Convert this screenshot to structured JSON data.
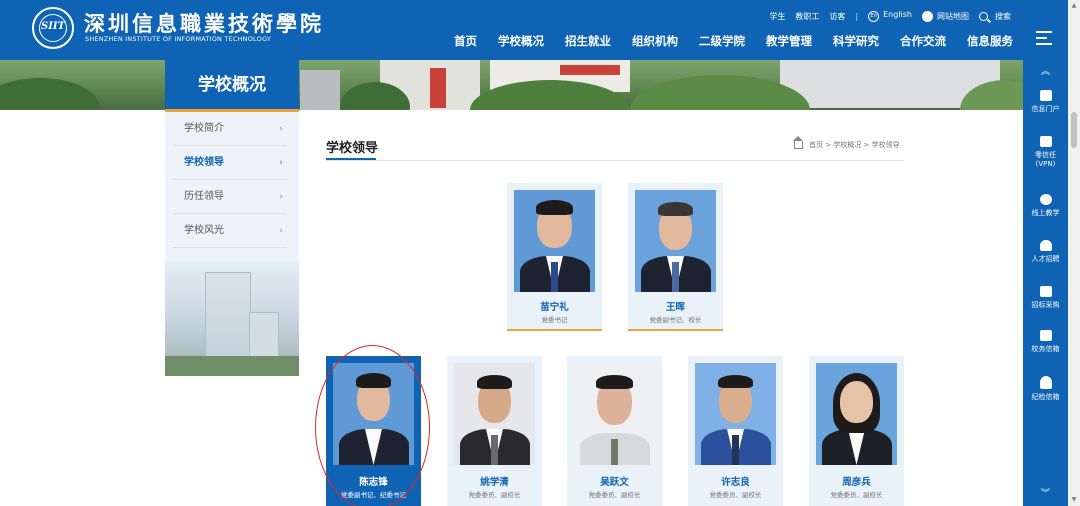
{
  "header": {
    "logo_text": "SIIT",
    "school_name_cn": "深圳信息職業技術學院",
    "school_name_en": "SHENZHEN INSTITUTE OF INFORMATION TECHNOLOGY",
    "top_links": [
      "学生",
      "教职工",
      "访客"
    ],
    "separator": "|",
    "english_label": "English",
    "en_badge": "En",
    "sitemap_label": "网站地图",
    "search_label": "搜索",
    "nav": [
      "首页",
      "学校概况",
      "招生就业",
      "组织机构",
      "二级学院",
      "教学管理",
      "科学研究",
      "合作交流",
      "信息服务"
    ]
  },
  "section": {
    "title": "学校概况",
    "menu": [
      {
        "label": "学校简介",
        "active": false
      },
      {
        "label": "学校领导",
        "active": true
      },
      {
        "label": "历任领导",
        "active": false
      },
      {
        "label": "学校风光",
        "active": false
      }
    ],
    "chevron": "›"
  },
  "main": {
    "title": "学校领导",
    "breadcrumb": "首页 > 学校概况 > 学校领导"
  },
  "leaders_row1": [
    {
      "name": "苗宁礼",
      "role": "党委书记"
    },
    {
      "name": "王晖",
      "role": "党委副书记、校长"
    }
  ],
  "leaders_row2": [
    {
      "name": "陈志锋",
      "role": "党委副书记、纪委书记"
    },
    {
      "name": "姚学清",
      "role": "党委委员、副校长"
    },
    {
      "name": "吴跃文",
      "role": "党委委员、副校长"
    },
    {
      "name": "许志良",
      "role": "党委委员、副校长"
    },
    {
      "name": "周彦兵",
      "role": "党委委员、副校长"
    }
  ],
  "right_bar": {
    "up_arrow": "︽",
    "down_arrow": "︾",
    "items": [
      {
        "label": "信息门户",
        "icon": "monitor-icon"
      },
      {
        "label": "零信任(VPN)",
        "icon": "vpn-icon"
      },
      {
        "label": "线上教学",
        "icon": "teaching-icon"
      },
      {
        "label": "人才招聘",
        "icon": "person-icon"
      },
      {
        "label": "招标采购",
        "icon": "purchase-icon"
      },
      {
        "label": "校务信箱",
        "icon": "mail-icon"
      },
      {
        "label": "纪检信箱",
        "icon": "inspection-mail-icon"
      }
    ]
  },
  "colors": {
    "primary": "#0f63b4",
    "accent": "#f0a23a",
    "highlight_circle": "#d9262b"
  }
}
